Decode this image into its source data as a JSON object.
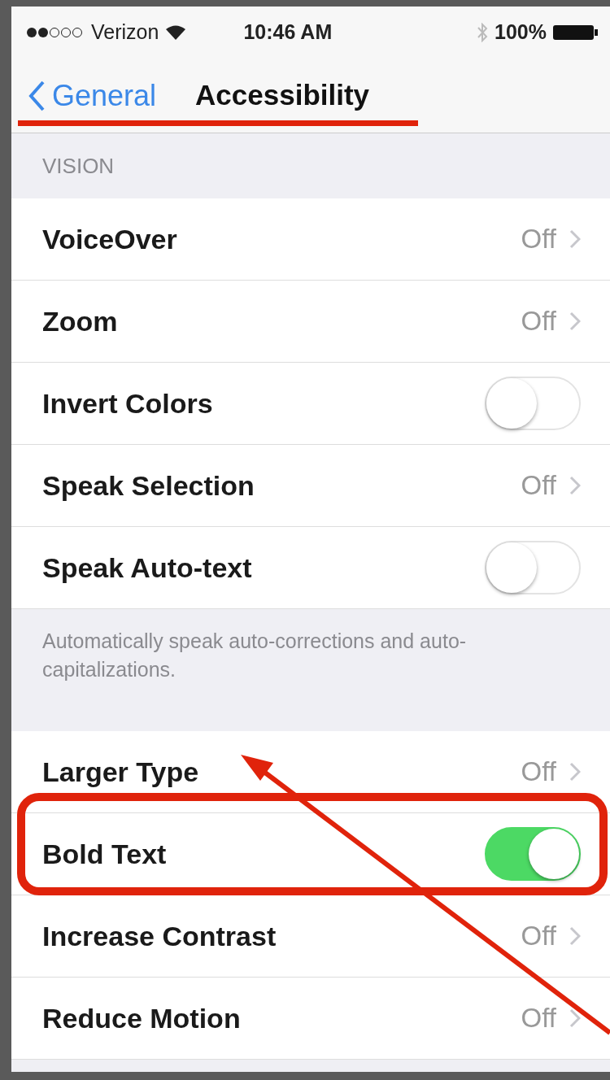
{
  "status_bar": {
    "carrier": "Verizon",
    "time": "10:46 AM",
    "battery": "100%"
  },
  "nav": {
    "back": "General",
    "title": "Accessibility"
  },
  "sections": [
    {
      "header": "VISION",
      "rows": [
        {
          "kind": "link",
          "label": "VoiceOver",
          "value": "Off"
        },
        {
          "kind": "link",
          "label": "Zoom",
          "value": "Off"
        },
        {
          "kind": "toggle",
          "label": "Invert Colors",
          "on": false
        },
        {
          "kind": "link",
          "label": "Speak Selection",
          "value": "Off"
        },
        {
          "kind": "toggle",
          "label": "Speak Auto-text",
          "on": false
        }
      ],
      "footer": "Automatically speak auto-corrections and auto-capitalizations."
    },
    {
      "rows": [
        {
          "kind": "link",
          "label": "Larger Type",
          "value": "Off"
        },
        {
          "kind": "toggle",
          "label": "Bold Text",
          "on": true
        },
        {
          "kind": "link",
          "label": "Increase Contrast",
          "value": "Off"
        },
        {
          "kind": "link",
          "label": "Reduce Motion",
          "value": "Off"
        }
      ]
    }
  ]
}
